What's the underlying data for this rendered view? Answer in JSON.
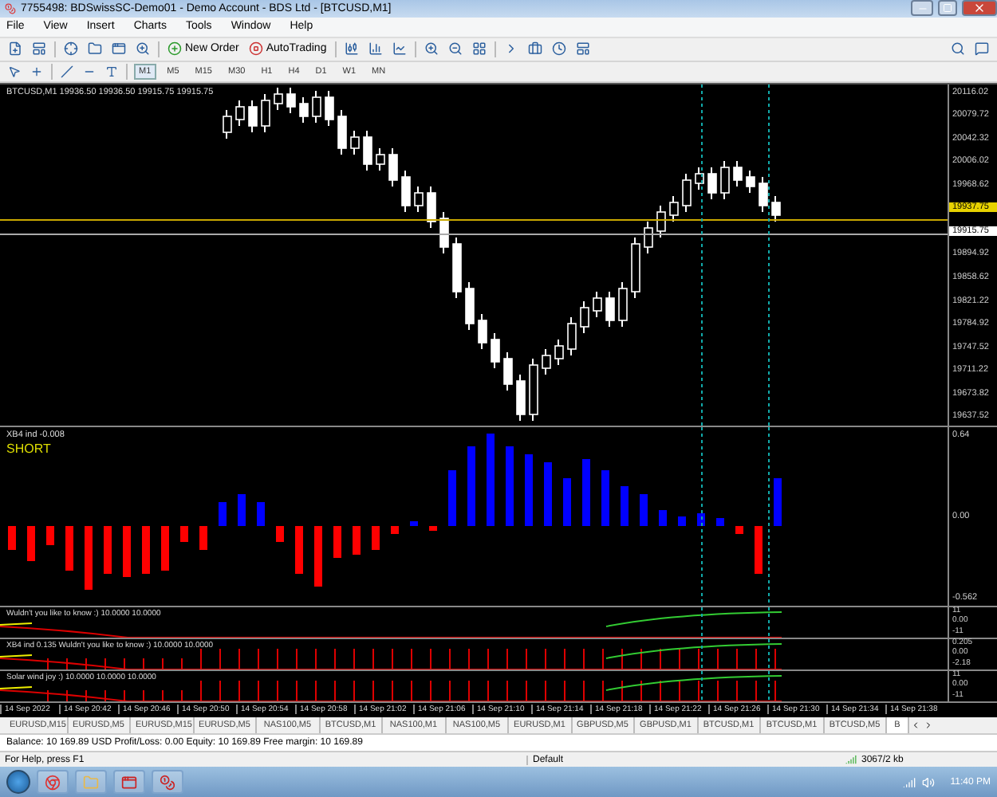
{
  "window": {
    "title": "7755498: BDSwissSC-Demo01 - Demo Account - BDS Ltd - [BTCUSD,M1]"
  },
  "menu": [
    "File",
    "View",
    "Insert",
    "Charts",
    "Tools",
    "Window",
    "Help"
  ],
  "toolbar": {
    "buttons": [
      {
        "label": "New Order",
        "kind": "order"
      },
      {
        "label": "AutoTrading",
        "kind": "auto"
      }
    ]
  },
  "timeframes": [
    {
      "label": "M1",
      "selected": true
    },
    {
      "label": "M5",
      "selected": false
    },
    {
      "label": "M15",
      "selected": false
    },
    {
      "label": "M30",
      "selected": false
    },
    {
      "label": "H1",
      "selected": false
    },
    {
      "label": "H4",
      "selected": false
    },
    {
      "label": "D1",
      "selected": false
    },
    {
      "label": "W1",
      "selected": false
    },
    {
      "label": "MN",
      "selected": false
    }
  ],
  "chart": {
    "header": "BTCUSD,M1  19936.50 19936.50 19915.75 19915.75",
    "price_labels": [
      {
        "text": "20116.02",
        "kind": "tick"
      },
      {
        "text": "20079.72",
        "kind": "tick"
      },
      {
        "text": "20042.32",
        "kind": "tick"
      },
      {
        "text": "20006.02",
        "kind": "tick"
      },
      {
        "text": "19968.62",
        "kind": "tick"
      },
      {
        "text": "19937.75",
        "kind": "ask"
      },
      {
        "text": "19915.75",
        "kind": "bid"
      },
      {
        "text": "19894.92",
        "kind": "tick"
      },
      {
        "text": "19858.62",
        "kind": "tick"
      },
      {
        "text": "19821.22",
        "kind": "tick"
      },
      {
        "text": "19784.92",
        "kind": "tick"
      },
      {
        "text": "19747.52",
        "kind": "tick"
      },
      {
        "text": "19711.22",
        "kind": "tick"
      },
      {
        "text": "19673.82",
        "kind": "tick"
      },
      {
        "text": "19637.52",
        "kind": "tick"
      }
    ]
  },
  "indicator": {
    "label": "XB4 ind -0.008",
    "signal": "SHORT",
    "scale": [
      "0.64",
      "0.00",
      "-0.562"
    ]
  },
  "sub_panes": [
    {
      "label": "Wuldn't you like to know :) 10.0000 10.0000",
      "ticks": false,
      "scale": [
        "11",
        "0.00",
        "-11"
      ]
    },
    {
      "label": "XB4 ind 0.135  Wuldn't you like to know :) 10.0000 10.0000",
      "ticks": true,
      "scale": [
        "0.205",
        "0.00",
        "-2.18"
      ]
    },
    {
      "label": "Solar wind joy :) 10.0000 10.0000 10.0000",
      "ticks": true,
      "scale": [
        "11",
        "0.00",
        "-11"
      ]
    }
  ],
  "time_labels": [
    "14 Sep 2022",
    "14 Sep 20:42",
    "14 Sep 20:46",
    "14 Sep 20:50",
    "14 Sep 20:54",
    "14 Sep 20:58",
    "14 Sep 21:02",
    "14 Sep 21:06",
    "14 Sep 21:10",
    "14 Sep 21:14",
    "14 Sep 21:18",
    "14 Sep 21:22",
    "14 Sep 21:26",
    "14 Sep 21:30",
    "14 Sep 21:34",
    "14 Sep 21:38"
  ],
  "tabs": [
    {
      "label": "EURUSD,M15",
      "selected": false
    },
    {
      "label": "EURUSD,M5",
      "selected": false
    },
    {
      "label": "EURUSD,M15",
      "selected": false
    },
    {
      "label": "EURUSD,M5",
      "selected": false
    },
    {
      "label": "NAS100,M5",
      "selected": false
    },
    {
      "label": "BTCUSD,M1",
      "selected": false
    },
    {
      "label": "NAS100,M1",
      "selected": false
    },
    {
      "label": "NAS100,M5",
      "selected": false
    },
    {
      "label": "EURUSD,M1",
      "selected": false
    },
    {
      "label": "GBPUSD,M5",
      "selected": false
    },
    {
      "label": "GBPUSD,M1",
      "selected": false
    },
    {
      "label": "BTCUSD,M1",
      "selected": false
    },
    {
      "label": "BTCUSD,M1",
      "selected": false
    },
    {
      "label": "BTCUSD,M5",
      "selected": false
    },
    {
      "label": "B",
      "selected": true
    }
  ],
  "terminal": {
    "account": "Balance: 10 169.89 USD  Profit/Loss: 0.00  Equity: 10 169.89  Free margin: 10 169.89"
  },
  "status_bar": {
    "help": "For Help, press F1",
    "profile": "Default",
    "traffic": "3067/2 kb"
  },
  "taskbar": {
    "clock": "11:40 PM"
  }
}
